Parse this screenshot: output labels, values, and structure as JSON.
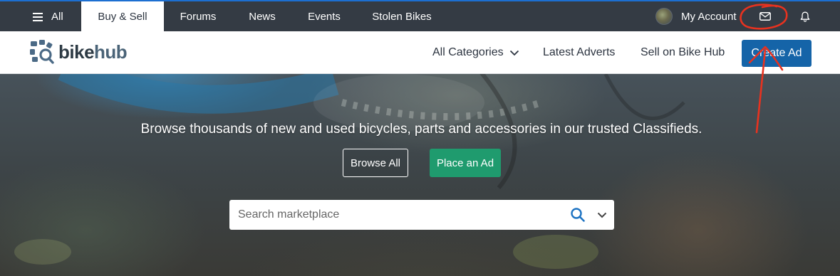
{
  "topbar": {
    "tabs": [
      {
        "label": "All",
        "icon": "hamburger-menu-icon"
      },
      {
        "label": "Buy & Sell",
        "active": true
      },
      {
        "label": "Forums"
      },
      {
        "label": "News"
      },
      {
        "label": "Events"
      },
      {
        "label": "Stolen Bikes"
      }
    ],
    "account_label": "My Account",
    "icons": [
      "avatar",
      "mail-icon",
      "bell-icon"
    ]
  },
  "navbar": {
    "logo_part1": "bike",
    "logo_part2": "hub",
    "links": [
      "All Categories",
      "Latest Adverts",
      "Sell on Bike Hub"
    ],
    "create_button": "Create Ad"
  },
  "hero": {
    "tagline": "Browse thousands of new and used bicycles, parts and accessories in our trusted Classifieds.",
    "browse_button": "Browse All",
    "place_button": "Place an Ad",
    "search_placeholder": "Search marketplace"
  },
  "colors": {
    "topbar_bg": "#343b44",
    "primary_blue": "#1564a8",
    "green": "#1f9b6e",
    "annotation_red": "#e8321f"
  }
}
